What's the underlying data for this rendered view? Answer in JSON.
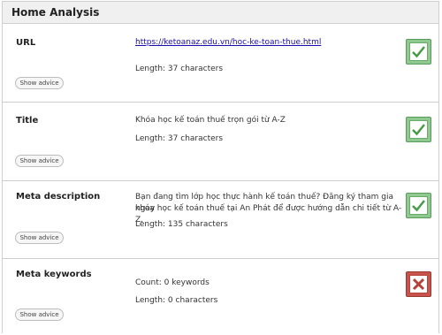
{
  "panel": {
    "title": "Home Analysis"
  },
  "sections": [
    {
      "label": "URL",
      "link": "https://ketoanaz.edu.vn/hoc-ke-toan-thue.html",
      "length_text": "Length: 37 characters",
      "advice_label": "Show advice",
      "status": "pass",
      "status_icon": "checkmark-icon"
    },
    {
      "label": "Title",
      "text": "Khóa học kế toán thuế trọn gói từ A-Z",
      "length_text": "Length: 37 characters",
      "advice_label": "Show advice",
      "status": "pass",
      "status_icon": "checkmark-icon"
    },
    {
      "label": "Meta description",
      "text_line1": "Bạn đang tìm lớp học thực hành kế toán thuế? Đăng ký tham gia ngay",
      "text_line2": "khóa học kế toán thuế tại An Phát để được hướng dẫn chi tiết từ A-Z.",
      "length_text": "Length: 135 characters",
      "advice_label": "Show advice",
      "status": "pass",
      "status_icon": "checkmark-icon"
    },
    {
      "label": "Meta keywords",
      "count_text": "Count: 0 keywords",
      "length_text": "Length: 0 characters",
      "advice_label": "Show advice",
      "status": "fail",
      "status_icon": "x-mark-icon"
    }
  ],
  "colors": {
    "pass": "#8fc98f",
    "fail": "#c8534a",
    "link": "#1a0dab"
  }
}
